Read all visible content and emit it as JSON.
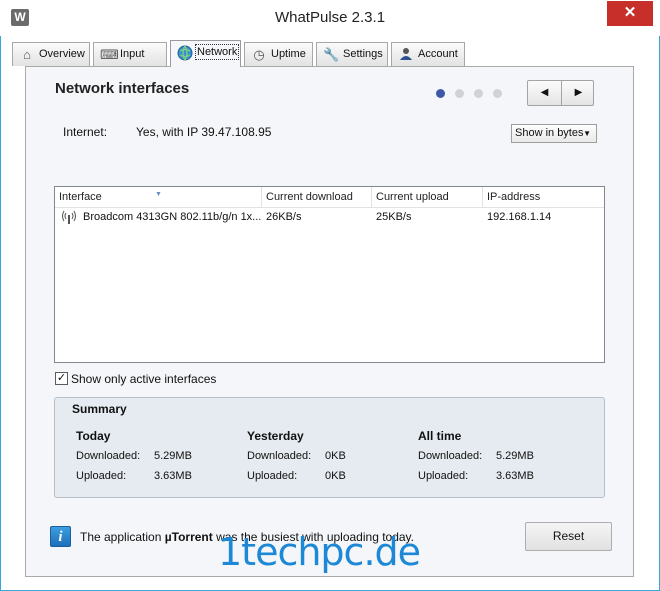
{
  "window": {
    "title": "WhatPulse 2.3.1",
    "app_icon": "W",
    "close_glyph": "✕",
    "accent_color": "#33a9dd",
    "close_color": "#c7302a"
  },
  "tabs": [
    {
      "label": "Overview",
      "icon": "home-icon"
    },
    {
      "label": "Input",
      "icon": "keyboard-icon"
    },
    {
      "label": "Network",
      "icon": "globe-icon",
      "active": true
    },
    {
      "label": "Uptime",
      "icon": "clock-icon"
    },
    {
      "label": "Settings",
      "icon": "wrench-icon"
    },
    {
      "label": "Account",
      "icon": "user-icon"
    }
  ],
  "page": {
    "heading": "Network interfaces",
    "pager": {
      "count": 4,
      "active_index": 0
    },
    "nav_prev": "◀",
    "nav_next": "▶"
  },
  "internet": {
    "label": "Internet:",
    "value": "Yes, with IP 39.47.108.95"
  },
  "unit_select": {
    "selected": "Show in bytes"
  },
  "table": {
    "columns": [
      "Interface",
      "Current download",
      "Current upload",
      "IP-address"
    ],
    "rows": [
      {
        "interface": "Broadcom 4313GN 802.11b/g/n 1x...",
        "download": "26KB/s",
        "upload": "25KB/s",
        "ip": "192.168.1.14"
      }
    ]
  },
  "filter": {
    "checked": true,
    "label": "Show only active interfaces"
  },
  "summary": {
    "title": "Summary",
    "downloaded_label": "Downloaded:",
    "uploaded_label": "Uploaded:",
    "today": {
      "title": "Today",
      "downloaded": "5.29MB",
      "uploaded": "3.63MB"
    },
    "yesterday": {
      "title": "Yesterday",
      "downloaded": "0KB",
      "uploaded": "0KB"
    },
    "all_time": {
      "title": "All time",
      "downloaded": "5.29MB",
      "uploaded": "3.63MB"
    }
  },
  "status": {
    "icon": "info-icon",
    "prefix": "The application ",
    "app": "µTorrent",
    "suffix": " was the busiest with uploading today."
  },
  "reset_label": "Reset",
  "watermark": "1techpc.de"
}
